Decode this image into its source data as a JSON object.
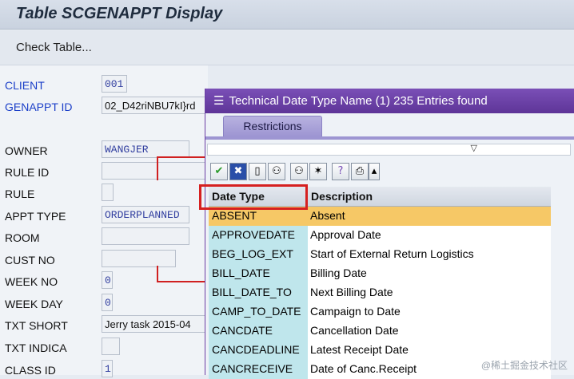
{
  "window": {
    "title": "Table SCGENAPPT Display"
  },
  "toolbar": {
    "check_table_label": "Check Table..."
  },
  "form": {
    "fields": [
      {
        "label": "CLIENT",
        "value": "001"
      },
      {
        "label": "GENAPPT ID",
        "value": "02_D42riNBU7kI}rd"
      },
      {
        "label": "OWNER",
        "value": "WANGJER"
      },
      {
        "label": "RULE ID",
        "value": ""
      },
      {
        "label": "RULE",
        "value": ""
      },
      {
        "label": "APPT TYPE",
        "value": "ORDERPLANNED"
      },
      {
        "label": "ROOM",
        "value": ""
      },
      {
        "label": "CUST NO",
        "value": ""
      },
      {
        "label": "WEEK NO",
        "value": "0"
      },
      {
        "label": "WEEK DAY",
        "value": "0"
      },
      {
        "label": "TXT SHORT",
        "value": "Jerry task 2015-04"
      },
      {
        "label": "TXT INDICA",
        "value": ""
      },
      {
        "label": "CLASS ID",
        "value": "1"
      }
    ]
  },
  "popup": {
    "title": "Technical Date Type Name (1)  235 Entries found",
    "tab_label": "Restrictions",
    "buttons": [
      "check-icon",
      "cancel-icon",
      "new-page-icon",
      "find-icon",
      "find-next-icon",
      "settings-icon",
      "help-icon",
      "print-icon",
      "menu-arrow-icon"
    ],
    "columns": [
      "Date Type",
      "Description"
    ],
    "rows": [
      {
        "type": "ABSENT",
        "desc": "Absent"
      },
      {
        "type": "APPROVEDATE",
        "desc": "Approval Date"
      },
      {
        "type": "BEG_LOG_EXT",
        "desc": "Start of External Return Logistics"
      },
      {
        "type": "BILL_DATE",
        "desc": "Billing Date"
      },
      {
        "type": "BILL_DATE_TO",
        "desc": "Next Billing Date"
      },
      {
        "type": "CAMP_TO_DATE",
        "desc": "Campaign to Date"
      },
      {
        "type": "CANCDATE",
        "desc": "Cancellation Date"
      },
      {
        "type": "CANCDEADLINE",
        "desc": "Latest Receipt Date"
      },
      {
        "type": "CANCRECEIVE",
        "desc": "Date of Canc.Receipt"
      }
    ],
    "selected_row": "ABSENT"
  },
  "watermark": "@稀土掘金技术社区",
  "colors": {
    "popup_title": "#6a43a8",
    "highlight": "#d62020",
    "selected_row": "#f6c866",
    "key_column": "#bfe6ec"
  }
}
